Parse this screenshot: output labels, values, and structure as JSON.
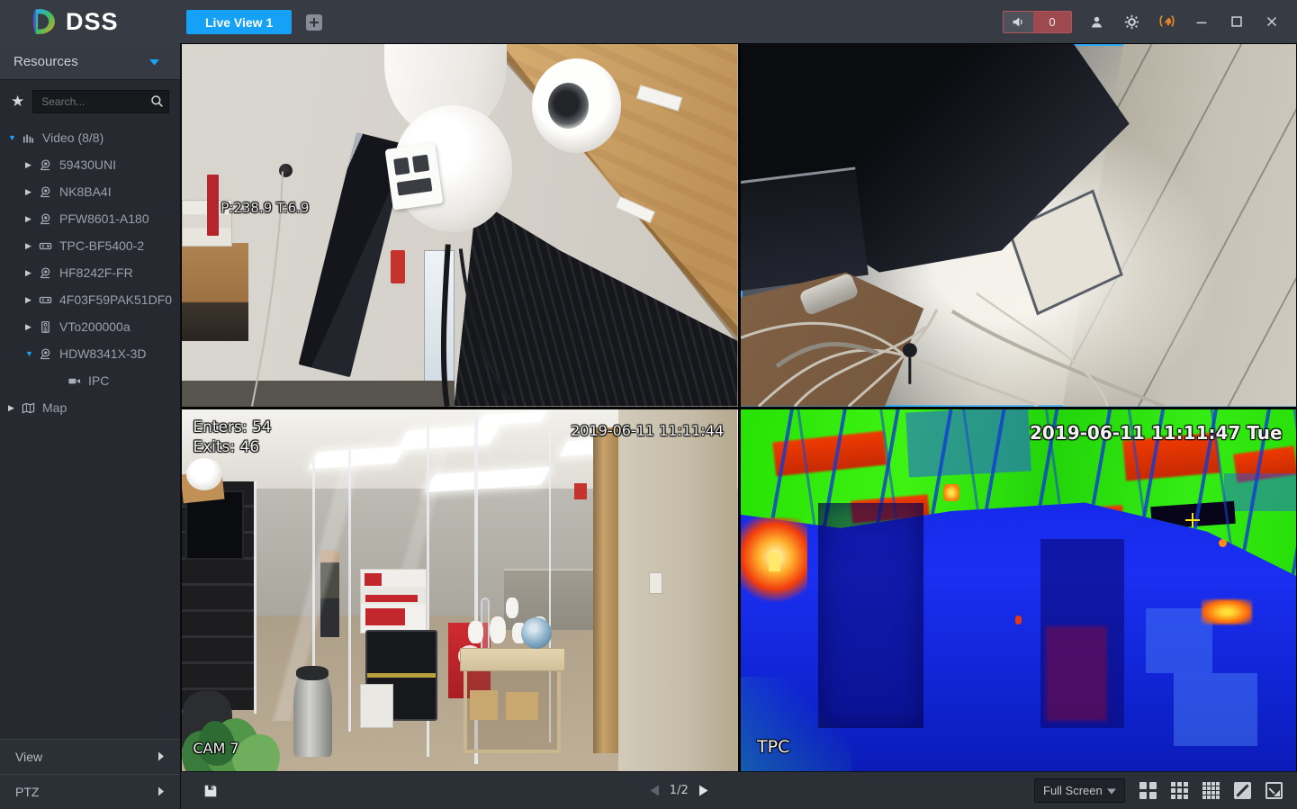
{
  "titlebar": {
    "logo_text": "DSS",
    "tabs": [
      {
        "label": "Live View 1",
        "active": true
      }
    ],
    "alarm_count": "0"
  },
  "sidebar": {
    "title": "Resources",
    "search_placeholder": "Search...",
    "tree": [
      {
        "label": "Video (8/8)",
        "level": 0,
        "state": "expanded",
        "icon": "matrix-icon"
      },
      {
        "label": "59430UNI",
        "level": 1,
        "state": "collapsed",
        "icon": "dome-camera-icon"
      },
      {
        "label": "NK8BA4I",
        "level": 1,
        "state": "collapsed",
        "icon": "dome-camera-icon"
      },
      {
        "label": "PFW8601-A180",
        "level": 1,
        "state": "collapsed",
        "icon": "dome-camera-icon"
      },
      {
        "label": "TPC-BF5400-2",
        "level": 1,
        "state": "collapsed",
        "icon": "thermal-camera-icon"
      },
      {
        "label": "HF8242F-FR",
        "level": 1,
        "state": "collapsed",
        "icon": "dome-camera-icon"
      },
      {
        "label": "4F03F59PAK51DF0",
        "level": 1,
        "state": "collapsed",
        "icon": "thermal-camera-icon"
      },
      {
        "label": "VTo200000a",
        "level": 1,
        "state": "collapsed",
        "icon": "vto-icon"
      },
      {
        "label": "HDW8341X-3D",
        "level": 1,
        "state": "expanded",
        "icon": "dome-camera-icon"
      },
      {
        "label": "IPC",
        "level": 2,
        "state": "leaf",
        "icon": "ipc-camera-icon"
      },
      {
        "label": "Map",
        "level": 0,
        "state": "collapsed",
        "icon": "map-icon"
      }
    ],
    "panels": [
      {
        "label": "View"
      },
      {
        "label": "PTZ"
      }
    ]
  },
  "video_grid": {
    "panes": [
      {
        "name": "camera-test-wall",
        "selected": false,
        "osd": {
          "ptz_position": "P:238.9 T:6.9"
        }
      },
      {
        "name": "desk-close-up",
        "selected": true,
        "osd": {}
      },
      {
        "name": "office-entrance",
        "selected": false,
        "osd": {
          "enters": "Enters: 54",
          "exits": "Exits: 46",
          "timestamp": "2019-06-11 11:11:44",
          "camera_label": "CAM 7"
        }
      },
      {
        "name": "thermal-view",
        "selected": false,
        "osd": {
          "timestamp": "2019-06-11 11:11:47 Tue",
          "camera_label": "TPC"
        }
      }
    ]
  },
  "statusbar": {
    "page_indicator": "1/2",
    "layout_select_value": "Full Screen"
  },
  "colors": {
    "accent_blue": "#14a1f6",
    "selection_border": "#2aa7f5",
    "alarm_red": "#9c4a4d",
    "topbar_bg": "#373b44",
    "sidebar_bg": "#26292f"
  }
}
